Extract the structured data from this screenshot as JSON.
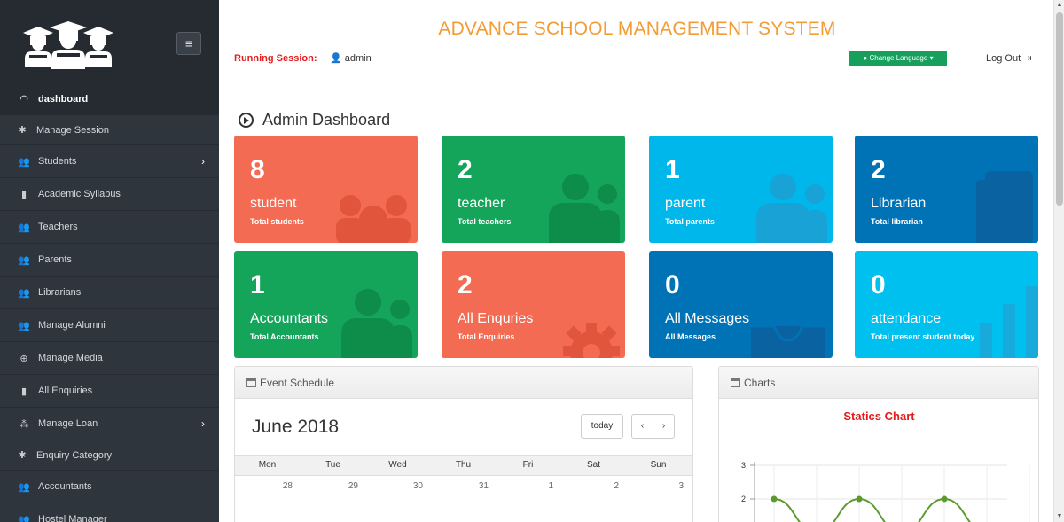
{
  "app": {
    "title": "ADVANCE SCHOOL MANAGEMENT SYSTEM"
  },
  "header": {
    "session_label": "Running Session:",
    "user": "admin",
    "language_button": "Change Language",
    "logout": "Log Out"
  },
  "sidebar": {
    "items": [
      {
        "label": "dashboard",
        "icon": "tachometer-icon"
      },
      {
        "label": "Manage Session",
        "icon": "gear-icon"
      },
      {
        "label": "Students",
        "icon": "users-icon",
        "has_submenu": true
      },
      {
        "label": "Academic Syllabus",
        "icon": "book-icon"
      },
      {
        "label": "Teachers",
        "icon": "users-icon"
      },
      {
        "label": "Parents",
        "icon": "users-icon"
      },
      {
        "label": "Librarians",
        "icon": "users-icon"
      },
      {
        "label": "Manage Alumni",
        "icon": "users-icon"
      },
      {
        "label": "Manage Media",
        "icon": "globe-icon"
      },
      {
        "label": "All Enquiries",
        "icon": "book-icon"
      },
      {
        "label": "Manage Loan",
        "icon": "sitemap-icon",
        "has_submenu": true
      },
      {
        "label": "Enquiry Category",
        "icon": "gear-icon"
      },
      {
        "label": "Accountants",
        "icon": "users-icon"
      },
      {
        "label": "Hostel Manager",
        "icon": "users-icon"
      }
    ]
  },
  "page": {
    "title": "Admin Dashboard"
  },
  "stats": [
    {
      "count": "8",
      "label": "student",
      "sub": "Total students",
      "color": "#f26b52"
    },
    {
      "count": "2",
      "label": "teacher",
      "sub": "Total teachers",
      "color": "#14a55b"
    },
    {
      "count": "1",
      "label": "parent",
      "sub": "Total parents",
      "color": "#00b7ec"
    },
    {
      "count": "2",
      "label": "Librarian",
      "sub": "Total librarian",
      "color": "#0073b7"
    },
    {
      "count": "1",
      "label": "Accountants",
      "sub": "Total Accountants",
      "color": "#14a55b"
    },
    {
      "count": "2",
      "label": "All Enquries",
      "sub": "Total Enquiries",
      "color": "#f26b52"
    },
    {
      "count": "0",
      "label": "All Messages",
      "sub": "All Messages",
      "color": "#0073b7"
    },
    {
      "count": "0",
      "label": "attendance",
      "sub": "Total present student today",
      "color": "#00c0ef"
    }
  ],
  "calendar": {
    "panel_title": "Event Schedule",
    "month": "June 2018",
    "today_label": "today",
    "prev_label": "‹",
    "next_label": "›",
    "weekdays": [
      "Mon",
      "Tue",
      "Wed",
      "Thu",
      "Fri",
      "Sat",
      "Sun"
    ],
    "first_week": [
      "28",
      "29",
      "30",
      "31",
      "1",
      "2",
      "3"
    ]
  },
  "charts_panel": {
    "panel_title": "Charts",
    "chart_title": "Statics Chart"
  },
  "chart_data": {
    "type": "line",
    "title": "Statics Chart",
    "ytick_labels": [
      "3",
      "2"
    ],
    "series": [
      {
        "values": [
          2,
          1,
          2,
          1,
          2,
          1
        ]
      }
    ],
    "line_color": "#5b9a2f"
  }
}
